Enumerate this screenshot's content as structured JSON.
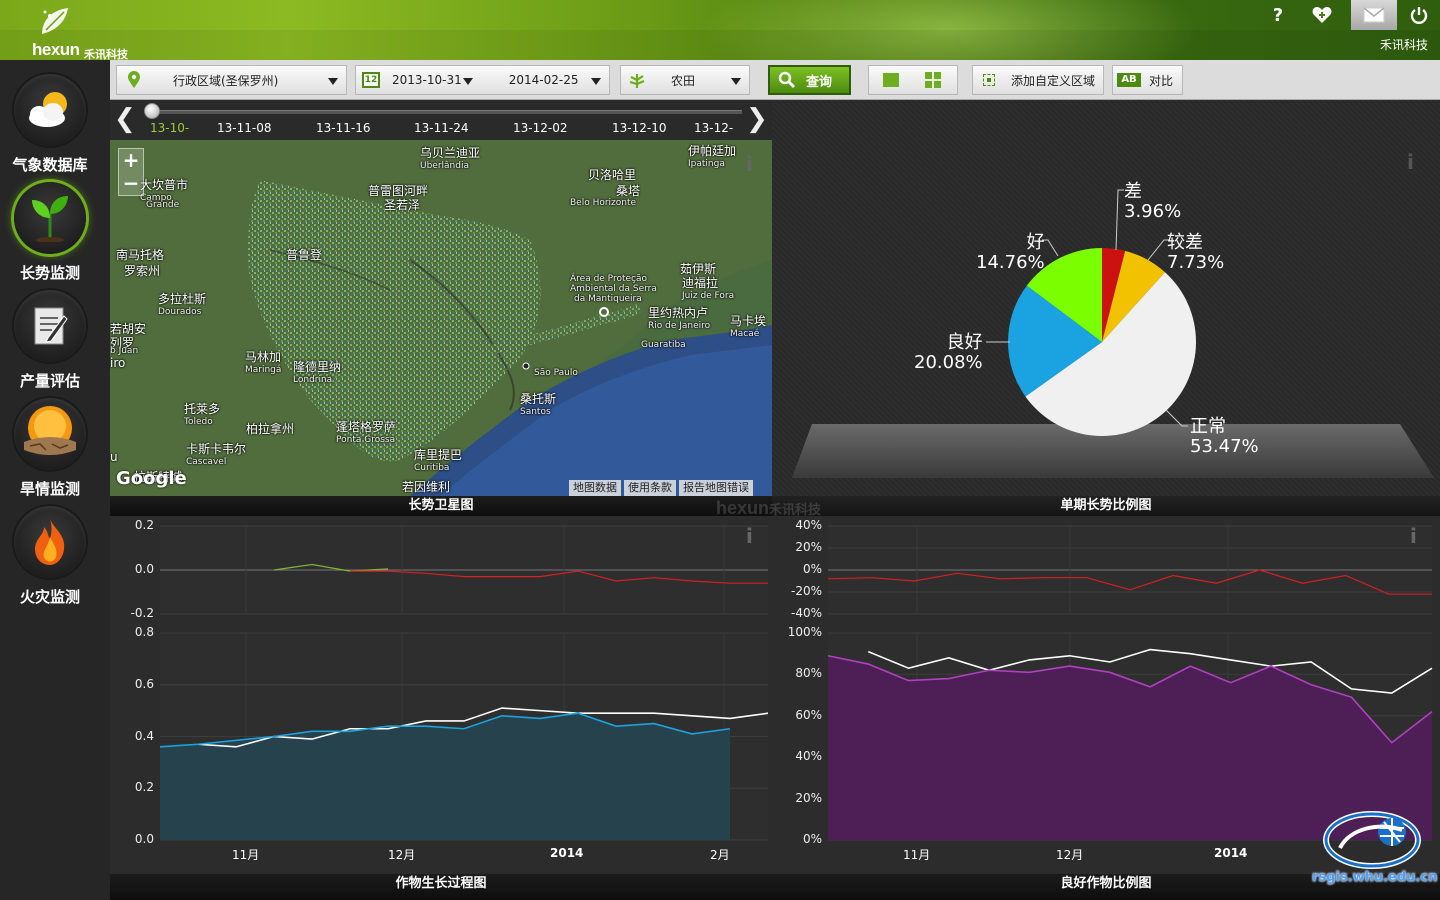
{
  "header": {
    "brand": "hexun",
    "brand_cn": "禾讯科技",
    "company_right": "禾讯科技",
    "help": "?"
  },
  "sidebar": {
    "items": [
      {
        "label": "气象数据库",
        "icon": "weather-icon"
      },
      {
        "label": "长势监测",
        "icon": "sprout-icon",
        "active": true
      },
      {
        "label": "产量评估",
        "icon": "report-icon"
      },
      {
        "label": "旱情监测",
        "icon": "drought-icon"
      },
      {
        "label": "火灾监测",
        "icon": "fire-icon"
      }
    ]
  },
  "toolbar": {
    "region": "行政区域(圣保罗州)",
    "date_start": "2013-10-31",
    "date_end": "2014-02-25",
    "date_badge": "12",
    "crop": "农田",
    "query": "查询",
    "custom_area": "添加自定义区域",
    "compare_badge": "AB",
    "compare": "对比"
  },
  "timeline": {
    "labels": [
      "13-10-",
      "13-11-08",
      "13-11-16",
      "13-11-24",
      "13-12-02",
      "13-12-10",
      "13-12-"
    ],
    "active_color": "#9acd32"
  },
  "map": {
    "title": "长势卫星图",
    "google": "Google",
    "attribution": [
      "地图数据",
      "使用条款",
      "报告地图错误"
    ],
    "labels": [
      {
        "t": "乌贝兰迪亚",
        "s": "Uberlândia"
      },
      {
        "t": "伊帕廷加",
        "s": "Ipatinga"
      },
      {
        "t": "大坎普市",
        "s": "Campo"
      },
      {
        "t": "贝洛哈里",
        "s": ""
      },
      {
        "t": "桑塔",
        "s": ""
      },
      {
        "t": "Belo Horizonte",
        "s": ""
      },
      {
        "t": "普雷图河畔",
        "s": ""
      },
      {
        "t": "圣若泽",
        "s": ""
      },
      {
        "t": "南马托格",
        "s": ""
      },
      {
        "t": "罗索州",
        "s": ""
      },
      {
        "t": "普鲁登",
        "s": ""
      },
      {
        "t": "多拉杜斯",
        "s": "Dourados"
      },
      {
        "t": "茹伊斯",
        "s": ""
      },
      {
        "t": "迪福拉",
        "s": "Juiz de Fora"
      },
      {
        "t": "里约热内卢",
        "s": "Rio de Janeiro"
      },
      {
        "t": "马卡埃",
        "s": "Macaé"
      },
      {
        "t": "Guaratiba",
        "s": ""
      },
      {
        "t": "马林加",
        "s": "Maringá"
      },
      {
        "t": "隆德里纳",
        "s": "Londrina"
      },
      {
        "t": "桑托斯",
        "s": "Santos"
      },
      {
        "t": "托莱多",
        "s": "Toledo"
      },
      {
        "t": "柏拉拿州",
        "s": ""
      },
      {
        "t": "蓬塔格罗萨",
        "s": "Ponta Grossa"
      },
      {
        "t": "卡斯卡韦尔",
        "s": "Cascavel"
      },
      {
        "t": "库里提巴",
        "s": "Curitiba"
      },
      {
        "t": "若因维利",
        "s": ""
      },
      {
        "t": "Área de Proteção",
        "s": "Ambiental da Serra"
      },
      {
        "t": "da Mantiqueira",
        "s": ""
      },
      {
        "t": "Grande",
        "s": ""
      },
      {
        "t": "São Paulo",
        "s": ""
      },
      {
        "t": "若胡安",
        "s": ""
      },
      {
        "t": "列罗",
        "s": ""
      },
      {
        "t": "b Juan",
        "s": ""
      },
      {
        "t": "iro",
        "s": ""
      },
      {
        "t": "拉斯特城",
        "s": ""
      },
      {
        "t": "u",
        "s": ""
      }
    ]
  },
  "pie": {
    "title": "单期长势比例图",
    "slices": [
      {
        "name": "差",
        "value": 3.96,
        "color": "#cc1111"
      },
      {
        "name": "较差",
        "value": 7.73,
        "color": "#f2c200"
      },
      {
        "name": "正常",
        "value": 53.47,
        "color": "#f0f0f0"
      },
      {
        "name": "良好",
        "value": 20.08,
        "color": "#1aa3e0"
      },
      {
        "name": "好",
        "value": 14.76,
        "color": "#7bff00"
      }
    ],
    "labels": [
      {
        "name": "差",
        "pct": "3.96%"
      },
      {
        "name": "较差",
        "pct": "7.73%"
      },
      {
        "name": "正常",
        "pct": "53.47%"
      },
      {
        "name": "良好",
        "pct": "20.08%"
      },
      {
        "name": "好",
        "pct": "14.76%"
      }
    ]
  },
  "growth": {
    "title": "作物生长过程图",
    "top_ticks": [
      "0.2",
      "0.0",
      "-0.2"
    ],
    "main_ticks": [
      "0.8",
      "0.6",
      "0.4",
      "0.2",
      "0.0"
    ],
    "x_labels": [
      "11月",
      "12月",
      "2014",
      "2月"
    ],
    "x_bold": [
      false,
      false,
      true,
      false
    ]
  },
  "ratio": {
    "title": "良好作物比例图",
    "top_ticks": [
      "40%",
      "20%",
      "0%",
      "-20%",
      "-40%"
    ],
    "main_ticks": [
      "100%",
      "80%",
      "60%",
      "40%",
      "20%",
      "0%"
    ],
    "x_labels": [
      "11月",
      "12月",
      "2014"
    ],
    "x_bold": [
      false,
      false,
      true
    ]
  },
  "chart_data": [
    {
      "type": "area",
      "title": "作物生长过程图",
      "ylim": [
        0,
        0.8
      ],
      "x": [
        0,
        1,
        2,
        3,
        4,
        5,
        6,
        7,
        8,
        9,
        10,
        11,
        12,
        13,
        14,
        15,
        16
      ],
      "series": [
        {
          "color": "#ffffff",
          "values": [
            null,
            0.37,
            0.36,
            0.4,
            0.39,
            0.43,
            0.43,
            0.46,
            0.46,
            0.51,
            0.5,
            0.49,
            0.49,
            0.49,
            0.48,
            0.47,
            0.49
          ]
        },
        {
          "color": "#1aa3e0",
          "values": [
            0.36,
            0.37,
            null,
            0.4,
            0.42,
            0.42,
            0.44,
            0.44,
            0.43,
            0.48,
            0.47,
            0.49,
            0.44,
            0.45,
            0.41,
            0.43,
            null
          ]
        }
      ]
    },
    {
      "type": "line",
      "title": "作物生长过程图 差值",
      "ylim": [
        -0.2,
        0.2
      ],
      "series": [
        {
          "color": "#7ab83a",
          "values": [
            null,
            null,
            null,
            0.0,
            0.025,
            -0.005,
            0.005,
            null,
            null,
            null,
            null,
            null,
            null,
            null,
            null,
            null,
            null
          ]
        },
        {
          "color": "#d42020",
          "values": [
            null,
            null,
            null,
            null,
            null,
            -0.005,
            -0.005,
            -0.015,
            -0.03,
            -0.03,
            -0.03,
            -0.005,
            -0.05,
            -0.035,
            -0.05,
            -0.06,
            -0.06
          ]
        }
      ]
    },
    {
      "type": "area",
      "title": "良好作物比例图",
      "ylim": [
        0,
        100
      ],
      "x": [
        0,
        1,
        2,
        3,
        4,
        5,
        6,
        7,
        8,
        9,
        10,
        11,
        12,
        13,
        14,
        15,
        16,
        17,
        18,
        19,
        20,
        21,
        22,
        23,
        24,
        25,
        26,
        27,
        28,
        29,
        30,
        31,
        32,
        33,
        34,
        35
      ],
      "series": [
        {
          "color": "#ffffff",
          "values": [
            null,
            null,
            91,
            null,
            83,
            null,
            88,
            null,
            82,
            null,
            87,
            null,
            89,
            null,
            86,
            null,
            92,
            null,
            90,
            null,
            87,
            null,
            84,
            null,
            86,
            null,
            73,
            null,
            71,
            null,
            83
          ]
        },
        {
          "color": "#b040c0",
          "values": [
            89,
            null,
            85,
            null,
            77,
            null,
            78,
            null,
            82,
            null,
            81,
            null,
            84,
            null,
            81,
            null,
            74,
            null,
            84,
            null,
            76,
            null,
            84,
            null,
            75,
            null,
            69,
            null,
            47,
            null,
            62
          ]
        }
      ]
    },
    {
      "type": "line",
      "title": "良好作物比例图 差值",
      "ylim": [
        -40,
        40
      ],
      "series": [
        {
          "color": "#d42020",
          "values": [
            -8,
            -7,
            -10,
            -3,
            -8,
            -7,
            -7,
            -18,
            -5,
            -12,
            0,
            -12,
            -5,
            -22,
            -22
          ]
        }
      ]
    }
  ]
}
